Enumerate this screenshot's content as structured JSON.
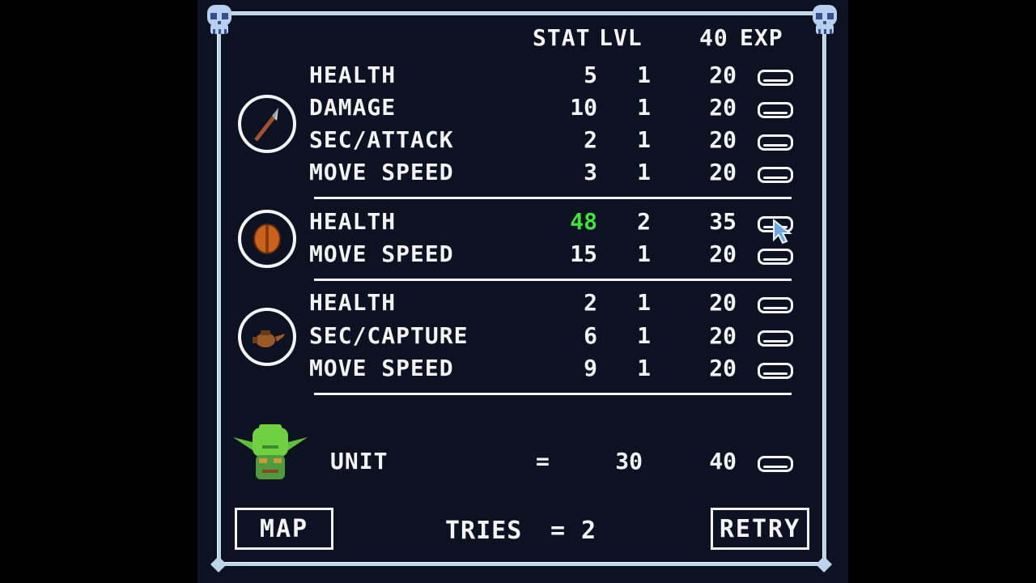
{
  "header": {
    "stat": "STAT",
    "lvl": "LVL",
    "exp_cost": "40",
    "exp": "EXP"
  },
  "groups": [
    {
      "icon": "spear-icon",
      "rows": [
        {
          "name": "HEALTH",
          "stat": "5",
          "lvl": "1",
          "exp": "20"
        },
        {
          "name": "DAMAGE",
          "stat": "10",
          "lvl": "1",
          "exp": "20"
        },
        {
          "name": "SEC/ATTACK",
          "stat": "2",
          "lvl": "1",
          "exp": "20"
        },
        {
          "name": "MOVE SPEED",
          "stat": "3",
          "lvl": "1",
          "exp": "20"
        }
      ]
    },
    {
      "icon": "barrel-icon",
      "rows": [
        {
          "name": "HEALTH",
          "stat": "48",
          "lvl": "2",
          "exp": "35"
        },
        {
          "name": "MOVE SPEED",
          "stat": "15",
          "lvl": "1",
          "exp": "20"
        }
      ]
    },
    {
      "icon": "teapot-icon",
      "rows": [
        {
          "name": "HEALTH",
          "stat": "2",
          "lvl": "1",
          "exp": "20"
        },
        {
          "name": "SEC/CAPTURE",
          "stat": "6",
          "lvl": "1",
          "exp": "20"
        },
        {
          "name": "MOVE SPEED",
          "stat": "9",
          "lvl": "1",
          "exp": "20"
        }
      ]
    }
  ],
  "unit": {
    "label": "UNIT",
    "equals": "=",
    "value": "30",
    "exp": "40"
  },
  "footer": {
    "map_label": "MAP",
    "tries_label": "TRIES",
    "tries_equals": "=",
    "tries_value": "2",
    "retry_label": "RETRY"
  },
  "colors": {
    "highlight": "#3fe23f",
    "frame": "#bcd5ea",
    "panel": "#0d1222"
  }
}
